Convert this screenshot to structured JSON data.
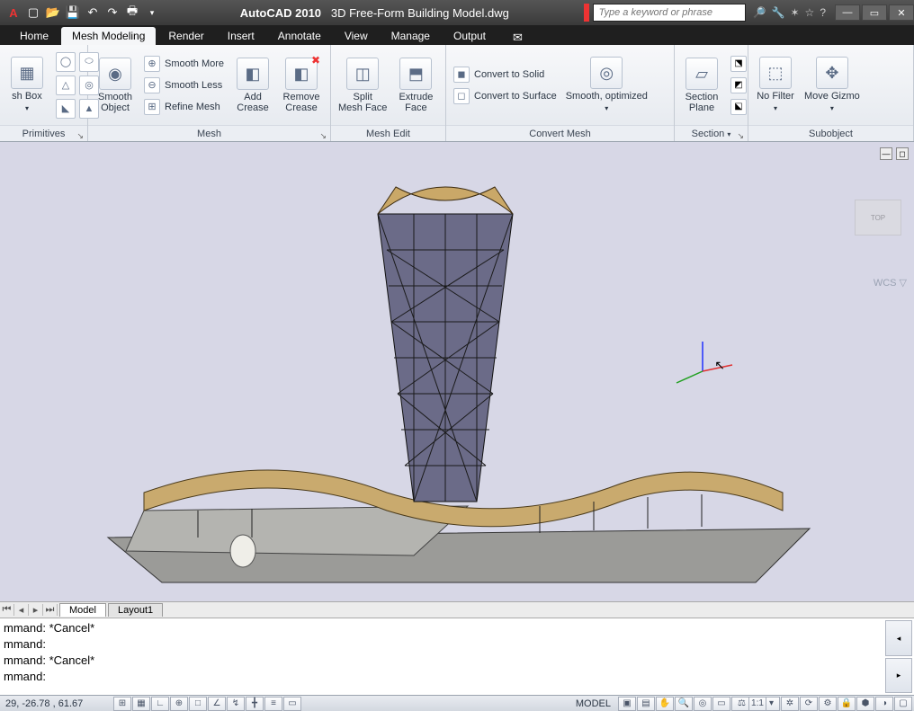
{
  "title": {
    "app": "AutoCAD 2010",
    "file": "3D Free-Form Building Model.dwg"
  },
  "search": {
    "placeholder": "Type a keyword or phrase"
  },
  "qat_icons": [
    "new",
    "open",
    "save",
    "undo",
    "redo",
    "plot"
  ],
  "tabs": [
    "Home",
    "Mesh Modeling",
    "Render",
    "Insert",
    "Annotate",
    "View",
    "Manage",
    "Output"
  ],
  "active_tab": "Mesh Modeling",
  "ribbon": {
    "primitives": {
      "label": "Primitives",
      "meshbox": "sh Box"
    },
    "mesh": {
      "label": "Mesh",
      "smooth_object": "Smooth\nObject",
      "smooth_more": "Smooth More",
      "smooth_less": "Smooth Less",
      "refine_mesh": "Refine Mesh",
      "add_crease": "Add\nCrease",
      "remove_crease": "Remove\nCrease"
    },
    "meshedit": {
      "label": "Mesh Edit",
      "split": "Split\nMesh Face",
      "extrude": "Extrude\nFace"
    },
    "convert": {
      "label": "Convert Mesh",
      "to_solid": "Convert to Solid",
      "to_surface": "Convert to Surface",
      "smooth_opt": "Smooth, optimized"
    },
    "section": {
      "label": "Section",
      "plane": "Section\nPlane"
    },
    "subobject": {
      "label": "Subobject",
      "nofilter": "No Filter",
      "gizmo": "Move Gizmo"
    }
  },
  "viewport": {
    "wcs": "WCS ▽",
    "viewcube": "TOP"
  },
  "mltabs": {
    "model": "Model",
    "layout": "Layout1"
  },
  "command_lines": [
    "mmand: *Cancel*",
    "mmand:",
    "mmand: *Cancel*",
    "mmand:"
  ],
  "status": {
    "coords": "29,  -26.78 , 61.67",
    "mode": "MODEL",
    "scale": "1:1"
  }
}
